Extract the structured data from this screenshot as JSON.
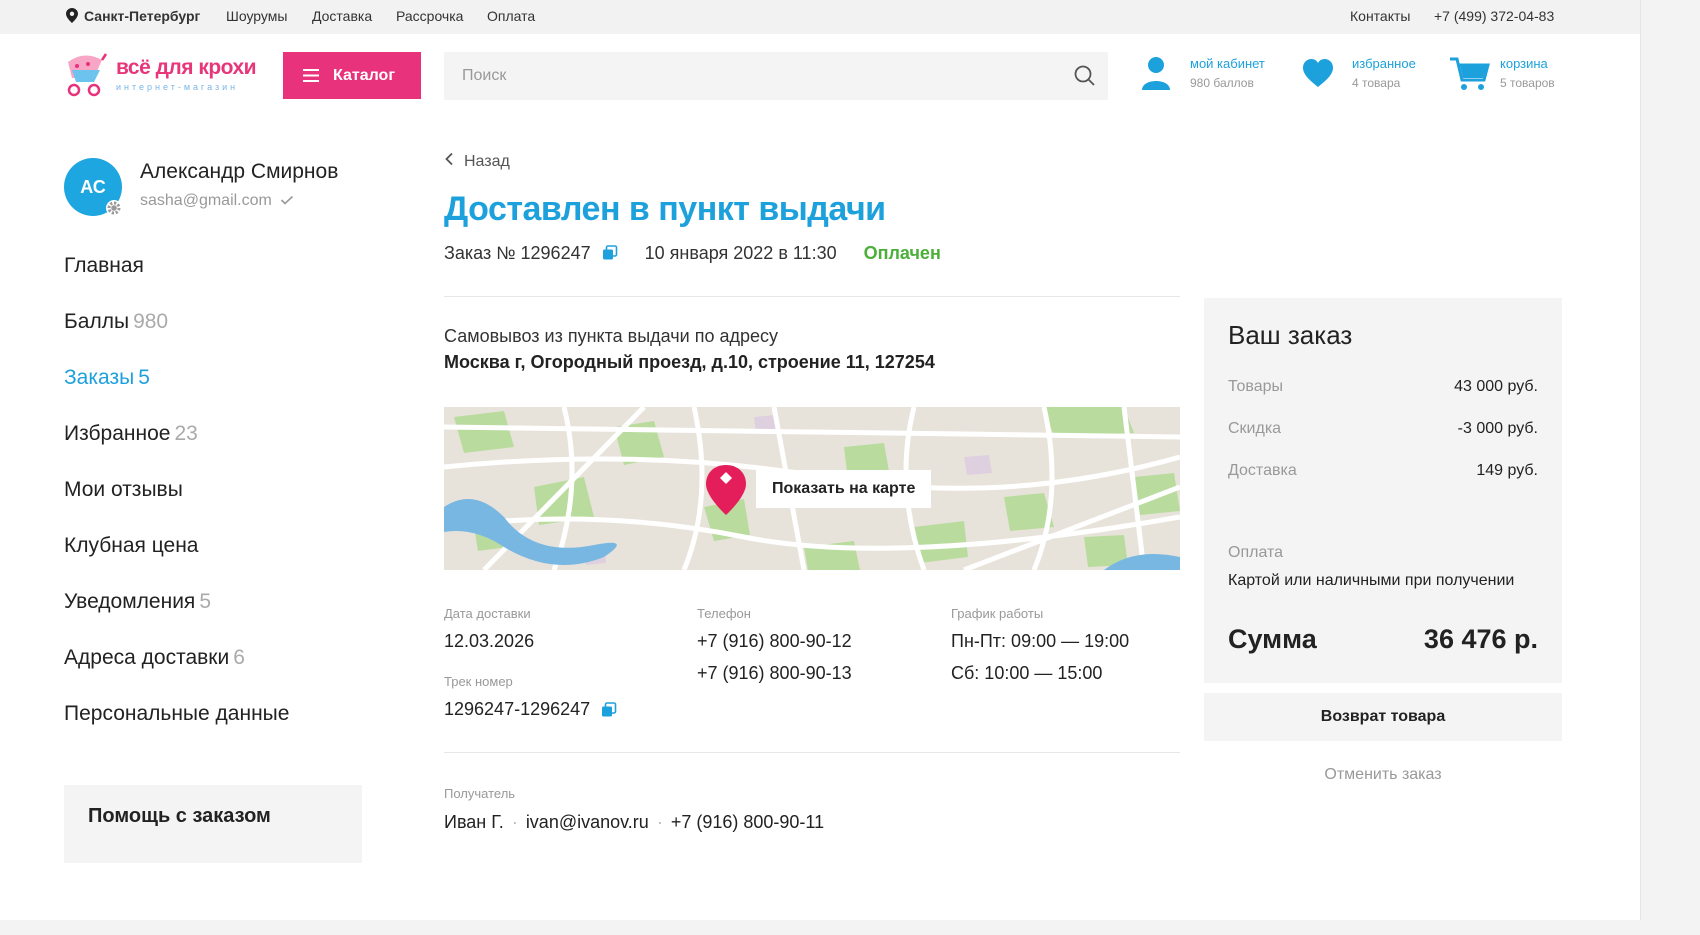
{
  "topbar": {
    "city": "Санкт-Петербург",
    "links": [
      "Шоурумы",
      "Доставка",
      "Рассрочка",
      "Оплата"
    ],
    "contacts_label": "Контакты",
    "phone": "+7 (499) 372-04-83"
  },
  "header": {
    "logo_text": "всё для крохи",
    "logo_subtext": "интернет-магазин",
    "catalog_label": "Каталог",
    "search_placeholder": "Поиск",
    "cabinet_label": "мой кабинет",
    "cabinet_sub": "980 баллов",
    "favorites_label": "избранное",
    "favorites_sub": "4 товара",
    "cart_label": "корзина",
    "cart_sub": "5 товаров"
  },
  "profile": {
    "initials": "АС",
    "name": "Александр Смирнов",
    "email": "sasha@gmail.com"
  },
  "sidebar": {
    "items": [
      {
        "label": "Главная",
        "count": ""
      },
      {
        "label": "Баллы",
        "count": "980"
      },
      {
        "label": "Заказы",
        "count": "5"
      },
      {
        "label": "Избранное",
        "count": "23"
      },
      {
        "label": "Мои отзывы",
        "count": ""
      },
      {
        "label": "Клубная цена",
        "count": ""
      },
      {
        "label": "Уведомления",
        "count": "5"
      },
      {
        "label": "Адреса доставки",
        "count": "6"
      },
      {
        "label": "Персональные данные",
        "count": ""
      }
    ],
    "help_title": "Помощь с заказом"
  },
  "order": {
    "back_label": "Назад",
    "title": "Доставлен в пункт выдачи",
    "number": "Заказ № 1296247",
    "datetime": "10 января 2022 в 11:30",
    "status": "Оплачен",
    "pickup_text": "Самовывоз из пункта выдачи по адресу",
    "pickup_address": "Москва г, Огородный проезд, д.10, строение 11, 127254",
    "show_on_map": "Показать на карте",
    "delivery_date_label": "Дата доставки",
    "delivery_date": "12.03.2026",
    "phone_label": "Телефон",
    "phones": [
      "+7 (916) 800-90-12",
      "+7 (916) 800-90-13"
    ],
    "schedule_label": "График работы",
    "schedule": [
      "Пн-Пт: 09:00 — 19:00",
      "Сб: 10:00 — 15:00"
    ],
    "track_label": "Трек номер",
    "track_number": "1296247-1296247",
    "recipient_label": "Получатель",
    "recipient_name": "Иван Г.",
    "recipient_email": "ivan@ivanov.ru",
    "recipient_phone": "+7 (916) 800-90-11"
  },
  "summary": {
    "title": "Ваш заказ",
    "goods_label": "Товары",
    "goods_value": "43 000 руб.",
    "discount_label": "Скидка",
    "discount_value": "-3 000 руб.",
    "delivery_label": "Доставка",
    "delivery_value": "149 руб.",
    "payment_label": "Оплата",
    "payment_value": "Картой или наличными при получении",
    "total_label": "Сумма",
    "total_value": "36 476 р.",
    "return_label": "Возврат товара",
    "cancel_label": "Отменить заказ"
  },
  "colors": {
    "accent_blue": "#1da1dc",
    "brand_pink": "#e8327b",
    "paid_green": "#4caf3a"
  }
}
